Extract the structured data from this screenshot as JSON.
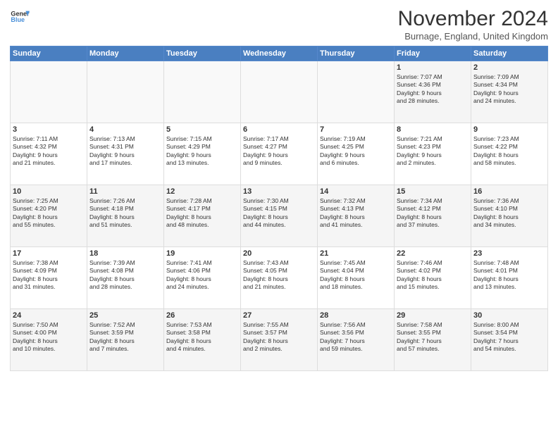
{
  "logo": {
    "line1": "General",
    "line2": "Blue"
  },
  "title": "November 2024",
  "location": "Burnage, England, United Kingdom",
  "days_header": [
    "Sunday",
    "Monday",
    "Tuesday",
    "Wednesday",
    "Thursday",
    "Friday",
    "Saturday"
  ],
  "weeks": [
    [
      {
        "day": "",
        "info": ""
      },
      {
        "day": "",
        "info": ""
      },
      {
        "day": "",
        "info": ""
      },
      {
        "day": "",
        "info": ""
      },
      {
        "day": "",
        "info": ""
      },
      {
        "day": "1",
        "info": "Sunrise: 7:07 AM\nSunset: 4:36 PM\nDaylight: 9 hours\nand 28 minutes."
      },
      {
        "day": "2",
        "info": "Sunrise: 7:09 AM\nSunset: 4:34 PM\nDaylight: 9 hours\nand 24 minutes."
      }
    ],
    [
      {
        "day": "3",
        "info": "Sunrise: 7:11 AM\nSunset: 4:32 PM\nDaylight: 9 hours\nand 21 minutes."
      },
      {
        "day": "4",
        "info": "Sunrise: 7:13 AM\nSunset: 4:31 PM\nDaylight: 9 hours\nand 17 minutes."
      },
      {
        "day": "5",
        "info": "Sunrise: 7:15 AM\nSunset: 4:29 PM\nDaylight: 9 hours\nand 13 minutes."
      },
      {
        "day": "6",
        "info": "Sunrise: 7:17 AM\nSunset: 4:27 PM\nDaylight: 9 hours\nand 9 minutes."
      },
      {
        "day": "7",
        "info": "Sunrise: 7:19 AM\nSunset: 4:25 PM\nDaylight: 9 hours\nand 6 minutes."
      },
      {
        "day": "8",
        "info": "Sunrise: 7:21 AM\nSunset: 4:23 PM\nDaylight: 9 hours\nand 2 minutes."
      },
      {
        "day": "9",
        "info": "Sunrise: 7:23 AM\nSunset: 4:22 PM\nDaylight: 8 hours\nand 58 minutes."
      }
    ],
    [
      {
        "day": "10",
        "info": "Sunrise: 7:25 AM\nSunset: 4:20 PM\nDaylight: 8 hours\nand 55 minutes."
      },
      {
        "day": "11",
        "info": "Sunrise: 7:26 AM\nSunset: 4:18 PM\nDaylight: 8 hours\nand 51 minutes."
      },
      {
        "day": "12",
        "info": "Sunrise: 7:28 AM\nSunset: 4:17 PM\nDaylight: 8 hours\nand 48 minutes."
      },
      {
        "day": "13",
        "info": "Sunrise: 7:30 AM\nSunset: 4:15 PM\nDaylight: 8 hours\nand 44 minutes."
      },
      {
        "day": "14",
        "info": "Sunrise: 7:32 AM\nSunset: 4:13 PM\nDaylight: 8 hours\nand 41 minutes."
      },
      {
        "day": "15",
        "info": "Sunrise: 7:34 AM\nSunset: 4:12 PM\nDaylight: 8 hours\nand 37 minutes."
      },
      {
        "day": "16",
        "info": "Sunrise: 7:36 AM\nSunset: 4:10 PM\nDaylight: 8 hours\nand 34 minutes."
      }
    ],
    [
      {
        "day": "17",
        "info": "Sunrise: 7:38 AM\nSunset: 4:09 PM\nDaylight: 8 hours\nand 31 minutes."
      },
      {
        "day": "18",
        "info": "Sunrise: 7:39 AM\nSunset: 4:08 PM\nDaylight: 8 hours\nand 28 minutes."
      },
      {
        "day": "19",
        "info": "Sunrise: 7:41 AM\nSunset: 4:06 PM\nDaylight: 8 hours\nand 24 minutes."
      },
      {
        "day": "20",
        "info": "Sunrise: 7:43 AM\nSunset: 4:05 PM\nDaylight: 8 hours\nand 21 minutes."
      },
      {
        "day": "21",
        "info": "Sunrise: 7:45 AM\nSunset: 4:04 PM\nDaylight: 8 hours\nand 18 minutes."
      },
      {
        "day": "22",
        "info": "Sunrise: 7:46 AM\nSunset: 4:02 PM\nDaylight: 8 hours\nand 15 minutes."
      },
      {
        "day": "23",
        "info": "Sunrise: 7:48 AM\nSunset: 4:01 PM\nDaylight: 8 hours\nand 13 minutes."
      }
    ],
    [
      {
        "day": "24",
        "info": "Sunrise: 7:50 AM\nSunset: 4:00 PM\nDaylight: 8 hours\nand 10 minutes."
      },
      {
        "day": "25",
        "info": "Sunrise: 7:52 AM\nSunset: 3:59 PM\nDaylight: 8 hours\nand 7 minutes."
      },
      {
        "day": "26",
        "info": "Sunrise: 7:53 AM\nSunset: 3:58 PM\nDaylight: 8 hours\nand 4 minutes."
      },
      {
        "day": "27",
        "info": "Sunrise: 7:55 AM\nSunset: 3:57 PM\nDaylight: 8 hours\nand 2 minutes."
      },
      {
        "day": "28",
        "info": "Sunrise: 7:56 AM\nSunset: 3:56 PM\nDaylight: 7 hours\nand 59 minutes."
      },
      {
        "day": "29",
        "info": "Sunrise: 7:58 AM\nSunset: 3:55 PM\nDaylight: 7 hours\nand 57 minutes."
      },
      {
        "day": "30",
        "info": "Sunrise: 8:00 AM\nSunset: 3:54 PM\nDaylight: 7 hours\nand 54 minutes."
      }
    ]
  ]
}
